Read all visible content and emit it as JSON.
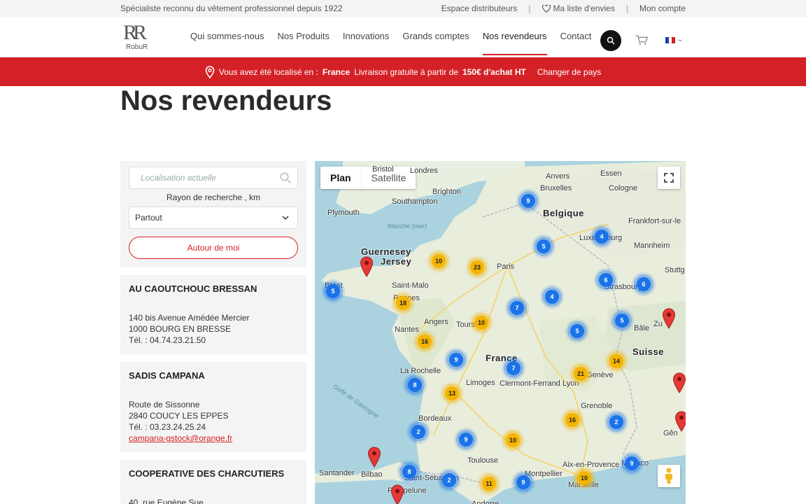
{
  "topbar": {
    "tagline": "Spécialiste reconnu du vêtement professionnel depuis 1922",
    "distributors": "Espace distributeurs",
    "wishlist": "Ma liste d'envies",
    "account": "Mon compte"
  },
  "header": {
    "logo_mark": "RR",
    "logo_word": "RobuR",
    "nav": [
      "Qui sommes-nous",
      "Nos Produits",
      "Innovations",
      "Grands comptes",
      "Nos revendeurs",
      "Contact"
    ],
    "active_nav": "Nos revendeurs",
    "icons": {
      "search": "search-icon",
      "cart": "cart-icon",
      "flag": "france-flag-icon"
    }
  },
  "banner": {
    "prefix": "Vous avez été localisé en :",
    "country": "France",
    "shipping_text": "Livraison gratuite à partir de",
    "shipping_amount": "150€ d'achat HT",
    "change": "Changer de pays"
  },
  "page": {
    "title": "Nos revendeurs"
  },
  "search": {
    "placeholder": "Localisation actuelle",
    "radius_label": "Rayon de recherche , km",
    "radius_value": "Partout",
    "around_me": "Autour de moi"
  },
  "stores": [
    {
      "name": "AU CAOUTCHOUC BRESSAN",
      "address": "140 bis Avenue Amédée Mercier",
      "city": "1000 BOURG EN BRESSE",
      "phone": "Tél. : 04.74.23.21.50",
      "email": ""
    },
    {
      "name": "SADIS CAMPANA",
      "address": "Route de Sissonne",
      "city": "2840 COUCY LES EPPES",
      "phone": "Tél. : 03.23.24.25.24",
      "email": "campana-gstock@orange.fr"
    },
    {
      "name": "COOPERATIVE DES CHARCUTIERS",
      "address": "40, rue Eugène Sue",
      "city": "",
      "phone": "",
      "email": ""
    }
  ],
  "map": {
    "tabs": [
      "Plan",
      "Satellite"
    ],
    "active_tab": "Plan",
    "labels": [
      {
        "text": "Bristol"
      },
      {
        "text": "Londres"
      },
      {
        "text": "Anvers"
      },
      {
        "text": "Essen"
      },
      {
        "text": "Brighton"
      },
      {
        "text": "Bruxelles"
      },
      {
        "text": "Cologne"
      },
      {
        "text": "Southampton"
      },
      {
        "text": "Belgique"
      },
      {
        "text": "Plymouth"
      },
      {
        "text": "Frankfort-sur-le"
      },
      {
        "text": "Manche (mer)"
      },
      {
        "text": "Luxembourg"
      },
      {
        "text": "Mannheim"
      },
      {
        "text": "Guernesey"
      },
      {
        "text": "Jersey"
      },
      {
        "text": "Paris"
      },
      {
        "text": "Stuttg"
      },
      {
        "text": "Saint-Malo"
      },
      {
        "text": "Strasbourg"
      },
      {
        "text": "Rennes"
      },
      {
        "text": "Angers"
      },
      {
        "text": "Tours"
      },
      {
        "text": "Nantes"
      },
      {
        "text": "Bâle"
      },
      {
        "text": "Zu"
      },
      {
        "text": "Suisse"
      },
      {
        "text": "France"
      },
      {
        "text": "La Rochelle"
      },
      {
        "text": "Genève"
      },
      {
        "text": "Limoges"
      },
      {
        "text": "Clermont-Ferrand"
      },
      {
        "text": "Lyon"
      },
      {
        "text": "Golfe de Gascogne"
      },
      {
        "text": "Grenoble"
      },
      {
        "text": "Bordeaux"
      },
      {
        "text": "Gên"
      },
      {
        "text": "Toulouse"
      },
      {
        "text": "Aix-en-Provence"
      },
      {
        "text": "Santander"
      },
      {
        "text": "Bilbao"
      },
      {
        "text": "Saint-Sébastien"
      },
      {
        "text": "Montpellier"
      },
      {
        "text": "Marseille"
      },
      {
        "text": "Monaco"
      },
      {
        "text": "Pampelune"
      },
      {
        "text": "Andorre"
      },
      {
        "text": "Brest"
      }
    ],
    "clusters": [
      {
        "count": "9",
        "color": "blue"
      },
      {
        "count": "5",
        "color": "blue"
      },
      {
        "count": "4",
        "color": "blue"
      },
      {
        "count": "10",
        "color": "orange"
      },
      {
        "count": "23",
        "color": "orange"
      },
      {
        "count": "6",
        "color": "blue"
      },
      {
        "count": "6",
        "color": "blue"
      },
      {
        "count": "5",
        "color": "blue"
      },
      {
        "count": "18",
        "color": "orange"
      },
      {
        "count": "7",
        "color": "blue"
      },
      {
        "count": "4",
        "color": "blue"
      },
      {
        "count": "10",
        "color": "orange"
      },
      {
        "count": "5",
        "color": "blue"
      },
      {
        "count": "5",
        "color": "blue"
      },
      {
        "count": "16",
        "color": "orange"
      },
      {
        "count": "9",
        "color": "blue"
      },
      {
        "count": "14",
        "color": "orange"
      },
      {
        "count": "7",
        "color": "blue"
      },
      {
        "count": "21",
        "color": "orange"
      },
      {
        "count": "8",
        "color": "blue"
      },
      {
        "count": "13",
        "color": "orange"
      },
      {
        "count": "16",
        "color": "orange"
      },
      {
        "count": "2",
        "color": "blue"
      },
      {
        "count": "2",
        "color": "blue"
      },
      {
        "count": "9",
        "color": "blue"
      },
      {
        "count": "10",
        "color": "orange"
      },
      {
        "count": "9",
        "color": "blue"
      },
      {
        "count": "8",
        "color": "blue"
      },
      {
        "count": "2",
        "color": "blue"
      },
      {
        "count": "11",
        "color": "orange"
      },
      {
        "count": "9",
        "color": "blue"
      },
      {
        "count": "10",
        "color": "orange"
      }
    ]
  },
  "colors": {
    "brand_red": "#d42127",
    "cluster_blue": "#1a73e8",
    "cluster_orange": "#f4b400"
  }
}
